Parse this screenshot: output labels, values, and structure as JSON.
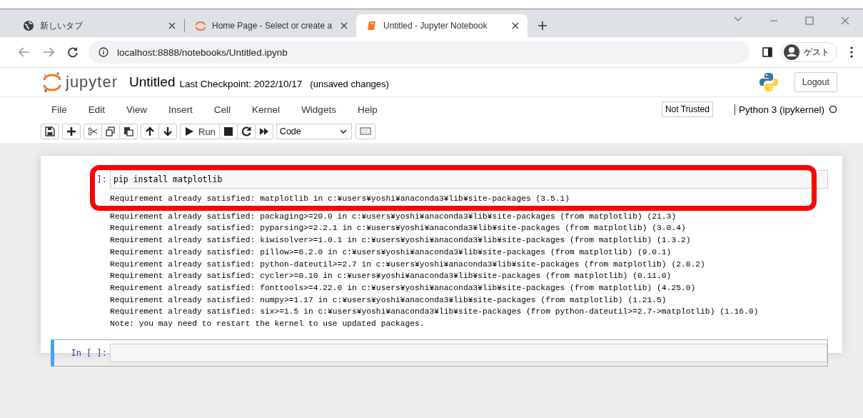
{
  "browser": {
    "tabs": [
      {
        "title": "新しいタブ",
        "kind": "globe",
        "selected": false
      },
      {
        "title": "Home Page - Select or create a",
        "kind": "jupyter",
        "selected": false
      },
      {
        "title": "Untitled - Jupyter Notebook",
        "kind": "notebook",
        "selected": true
      }
    ],
    "address": "localhost:8888/notebooks/Untitled.ipynb",
    "profile": "ゲスト"
  },
  "header": {
    "logo_text": "jupyter",
    "notebook_name": "Untitled",
    "checkpoint": "Last Checkpoint: 2022/10/17",
    "save_status": "(unsaved changes)",
    "logout": "Logout"
  },
  "menu": {
    "items": [
      "File",
      "Edit",
      "View",
      "Insert",
      "Cell",
      "Kernel",
      "Widgets",
      "Help"
    ],
    "trust": "Not Trusted",
    "kernel": "Python 3 (ipykernel)"
  },
  "toolbar": {
    "groups": [
      [
        {
          "kind": "save"
        }
      ],
      [
        {
          "kind": "add"
        }
      ],
      [
        {
          "kind": "cut"
        },
        {
          "kind": "copy"
        },
        {
          "kind": "paste"
        }
      ],
      [
        {
          "kind": "up"
        },
        {
          "kind": "down"
        }
      ],
      [
        {
          "kind": "run",
          "label": "Run"
        },
        {
          "kind": "stop"
        },
        {
          "kind": "restart"
        },
        {
          "kind": "forward"
        }
      ],
      [
        {
          "kind": "celltype",
          "label": "Code"
        }
      ],
      [
        {
          "kind": "keyboard"
        }
      ]
    ]
  },
  "cells": [
    {
      "prompt": "]:",
      "source": "pip install matplotlib",
      "selected": false,
      "highlighted": true,
      "output": [
        "Requirement already satisfied: matplotlib in c:¥users¥yoshi¥anaconda3¥lib¥site-packages (3.5.1)",
        "Requirement already satisfied: packaging>=20.0 in c:¥users¥yoshi¥anaconda3¥lib¥site-packages (from matplotlib) (21.3)",
        "Requirement already satisfied: pyparsing>=2.2.1 in c:¥users¥yoshi¥anaconda3¥lib¥site-packages (from matplotlib) (3.0.4)",
        "Requirement already satisfied: kiwisolver>=1.0.1 in c:¥users¥yoshi¥anaconda3¥lib¥site-packages (from matplotlib) (1.3.2)",
        "Requirement already satisfied: pillow>=6.2.0 in c:¥users¥yoshi¥anaconda3¥lib¥site-packages (from matplotlib) (9.0.1)",
        "Requirement already satisfied: python-dateutil>=2.7 in c:¥users¥yoshi¥anaconda3¥lib¥site-packages (from matplotlib) (2.8.2)",
        "Requirement already satisfied: cycler>=0.10 in c:¥users¥yoshi¥anaconda3¥lib¥site-packages (from matplotlib) (0.11.0)",
        "Requirement already satisfied: fonttools>=4.22.0 in c:¥users¥yoshi¥anaconda3¥lib¥site-packages (from matplotlib) (4.25.0)",
        "Requirement already satisfied: numpy>=1.17 in c:¥users¥yoshi¥anaconda3¥lib¥site-packages (from matplotlib) (1.21.5)",
        "Requirement already satisfied: six>=1.5 in c:¥users¥yoshi¥anaconda3¥lib¥site-packages (from python-dateutil>=2.7->matplotlib) (1.16.0)",
        "Note: you may need to restart the kernel to use updated packages."
      ]
    },
    {
      "prompt": "In [ ]:",
      "selected": true,
      "highlighted": false
    }
  ]
}
